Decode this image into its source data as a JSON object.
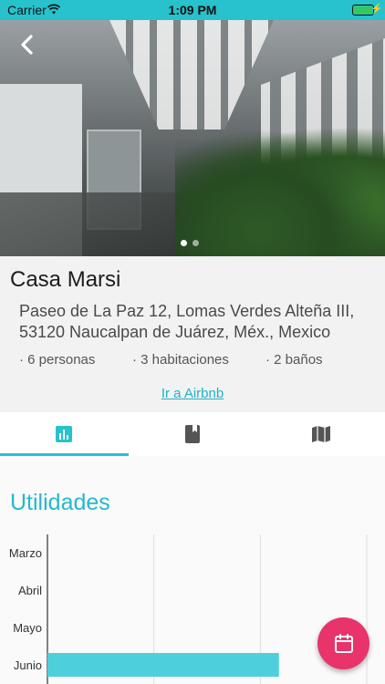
{
  "status_bar": {
    "carrier": "Carrier",
    "time": "1:09 PM"
  },
  "property": {
    "title": "Casa Marsi",
    "address": "Paseo de La Paz 12, Lomas Verdes Alteña III, 53120 Naucalpan de Juárez, Méx., Mexico",
    "features": [
      "· 6 personas",
      "· 3 habitaciones",
      "· 2 baños"
    ],
    "airbnb_link": "Ir a Airbnb"
  },
  "gallery": {
    "pages": 2,
    "active_page": 1
  },
  "tabs": [
    {
      "icon": "bar-chart-icon",
      "active": true
    },
    {
      "icon": "book-icon",
      "active": false
    },
    {
      "icon": "map-icon",
      "active": false
    }
  ],
  "section": {
    "title": "Utilidades"
  },
  "colors": {
    "accent": "#27c2cc",
    "fab": "#e8336b",
    "bar": "#4ecfdc"
  },
  "chart_data": {
    "type": "bar",
    "orientation": "horizontal",
    "categories": [
      "Marzo",
      "Abril",
      "Mayo",
      "Junio"
    ],
    "values": [
      0,
      0,
      0,
      0.87
    ],
    "xlim": [
      0,
      1.2
    ],
    "grid": true
  }
}
